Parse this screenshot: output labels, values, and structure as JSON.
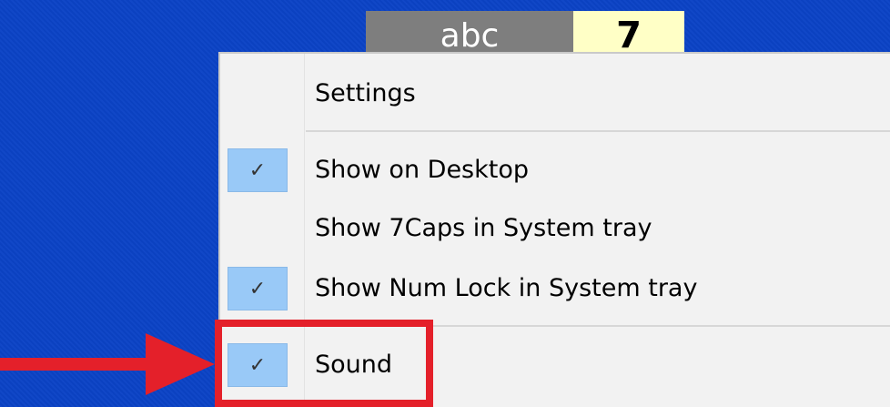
{
  "indicators": {
    "caps_text": "abc",
    "num_text": "7"
  },
  "menu": {
    "items": [
      {
        "label": "Settings",
        "checked": false
      },
      {
        "label": "Show on Desktop",
        "checked": true
      },
      {
        "label": "Show 7Caps in System tray",
        "checked": false
      },
      {
        "label": "Show Num Lock in System tray",
        "checked": true
      },
      {
        "label": "Sound",
        "checked": true
      }
    ],
    "check_glyph": "✓"
  },
  "annotation": {
    "color": "#e4202a",
    "highlighted_item": "Sound",
    "arrow_icon": "right-arrow-icon"
  }
}
